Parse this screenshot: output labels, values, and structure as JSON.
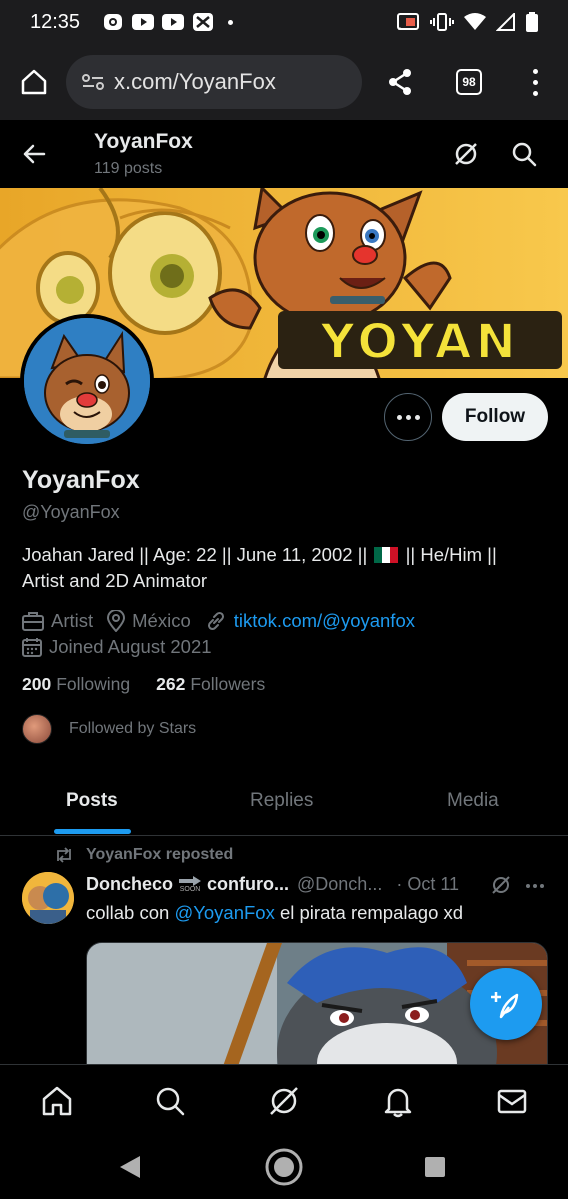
{
  "status_bar": {
    "time": "12:35"
  },
  "browser": {
    "url": "x.com/YoyanFox",
    "tab_count": "98"
  },
  "profile_header": {
    "name": "YoyanFox",
    "posts": "119 posts"
  },
  "banner": {
    "text": "YOYAN"
  },
  "actions": {
    "follow_label": "Follow"
  },
  "profile": {
    "display_name": "YoyanFox",
    "handle": "@YoyanFox",
    "bio_line1_a": "Joahan Jared || Age: 22 || June 11, 2002 ||",
    "bio_line1_b": "|| He/Him ||",
    "bio_line2": "Artist and 2D Animator",
    "category": "Artist",
    "location": "México",
    "website": "tiktok.com/@yoyanfox",
    "joined": "Joined August 2021",
    "following_count": "200",
    "following_label": "Following",
    "followers_count": "262",
    "followers_label": "Followers",
    "followed_by": "Followed by Stars"
  },
  "tabs": [
    {
      "label": "Posts"
    },
    {
      "label": "Replies"
    },
    {
      "label": "Media"
    }
  ],
  "tweet": {
    "repost_label": "YoyanFox reposted",
    "author_name": "Doncheco",
    "soon_label": "SOON",
    "author_name2": "confuro...",
    "author_handle": "@Donch...",
    "date": "· Oct 11",
    "text_a": "collab con",
    "mention": "@YoyanFox",
    "text_b": "el pirata rempalago xd"
  },
  "colors": {
    "accent": "#1d9bf0",
    "background": "#000000",
    "muted": "#71767b"
  }
}
